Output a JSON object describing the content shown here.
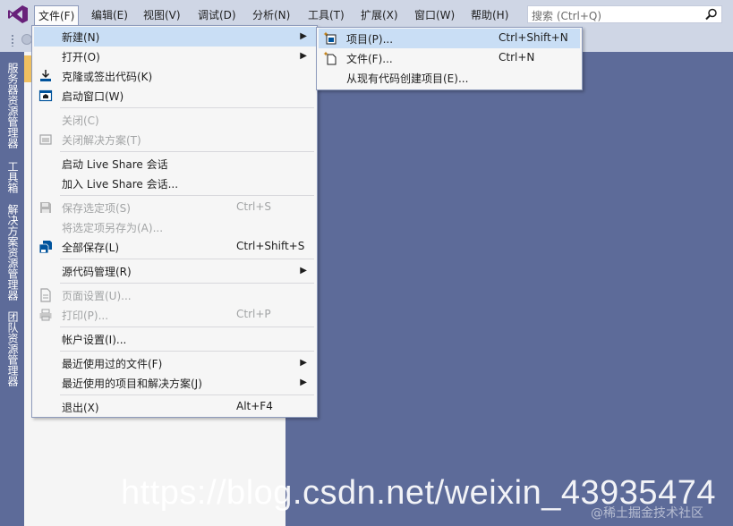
{
  "menubar": {
    "items": [
      {
        "label": "文件(F)"
      },
      {
        "label": "编辑(E)"
      },
      {
        "label": "视图(V)"
      },
      {
        "label": "调试(D)"
      },
      {
        "label": "分析(N)"
      },
      {
        "label": "工具(T)"
      },
      {
        "label": "扩展(X)"
      },
      {
        "label": "窗口(W)"
      },
      {
        "label": "帮助(H)"
      }
    ],
    "search_placeholder": "搜索 (Ctrl+Q)"
  },
  "sidebar": {
    "tabs": [
      "服务器资源管理器",
      "工具箱",
      "解决方案资源管理器",
      "团队资源管理器"
    ]
  },
  "file_menu": {
    "items": [
      {
        "label": "新建(N)",
        "shortcut": ""
      },
      {
        "label": "打开(O)",
        "shortcut": ""
      },
      {
        "label": "克隆或签出代码(K)",
        "shortcut": ""
      },
      {
        "label": "启动窗口(W)",
        "shortcut": ""
      },
      {
        "label": "关闭(C)",
        "shortcut": ""
      },
      {
        "label": "关闭解决方案(T)",
        "shortcut": ""
      },
      {
        "label": "启动 Live Share 会话",
        "shortcut": ""
      },
      {
        "label": "加入 Live Share 会话...",
        "shortcut": ""
      },
      {
        "label": "保存选定项(S)",
        "shortcut": "Ctrl+S"
      },
      {
        "label": "将选定项另存为(A)...",
        "shortcut": ""
      },
      {
        "label": "全部保存(L)",
        "shortcut": "Ctrl+Shift+S"
      },
      {
        "label": "源代码管理(R)",
        "shortcut": ""
      },
      {
        "label": "页面设置(U)...",
        "shortcut": ""
      },
      {
        "label": "打印(P)...",
        "shortcut": "Ctrl+P"
      },
      {
        "label": "帐户设置(I)...",
        "shortcut": ""
      },
      {
        "label": "最近使用过的文件(F)",
        "shortcut": ""
      },
      {
        "label": "最近使用的项目和解决方案(J)",
        "shortcut": ""
      },
      {
        "label": "退出(X)",
        "shortcut": "Alt+F4"
      }
    ]
  },
  "new_submenu": {
    "items": [
      {
        "label": "项目(P)...",
        "shortcut": "Ctrl+Shift+N"
      },
      {
        "label": "文件(F)...",
        "shortcut": "Ctrl+N"
      },
      {
        "label": "从现有代码创建项目(E)...",
        "shortcut": ""
      }
    ]
  },
  "watermark": {
    "url": "https://blog.csdn.net/weixin_43935474",
    "community": "@稀土掘金技术社区"
  },
  "colors": {
    "accent": "#68217a",
    "hover": "#c9def5",
    "background": "#5d6b99",
    "menubar": "#cfd6e5"
  }
}
